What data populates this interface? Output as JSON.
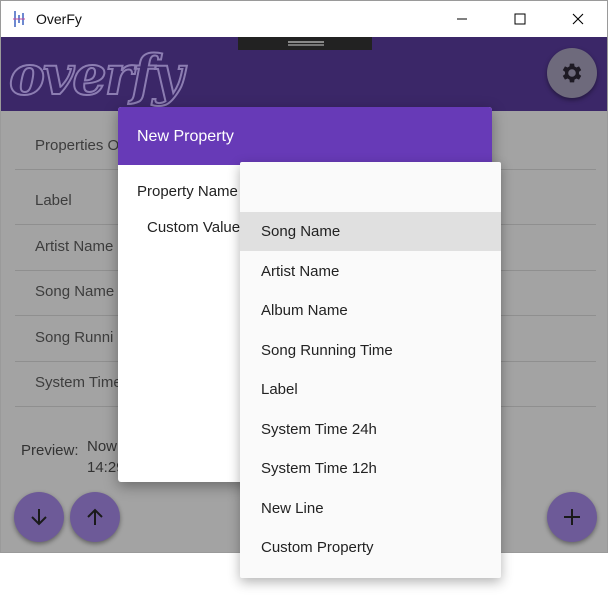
{
  "window": {
    "title": "OverFy"
  },
  "header": {
    "logo_text": "overfy"
  },
  "properties": {
    "rows": [
      "Properties O",
      "Label",
      "Artist Name",
      "Song Name",
      "Song Runni",
      "System Time"
    ],
    "preview_label": "Preview:",
    "preview_line1": "Now",
    "preview_line2": "14:29"
  },
  "modal": {
    "title": "New Property",
    "property_name_label": "Property Name",
    "custom_value_label": "Custom Value"
  },
  "dropdown": {
    "selected": "Song Name",
    "options": [
      "",
      "Song Name",
      "Artist Name",
      "Album Name",
      "Song Running Time",
      "Label",
      "System Time 24h",
      "System Time 12h",
      "New Line",
      "Custom Property"
    ]
  },
  "colors": {
    "accent": "#673ab7",
    "header": "#3b2768",
    "overlay": "#a3a3a3"
  }
}
